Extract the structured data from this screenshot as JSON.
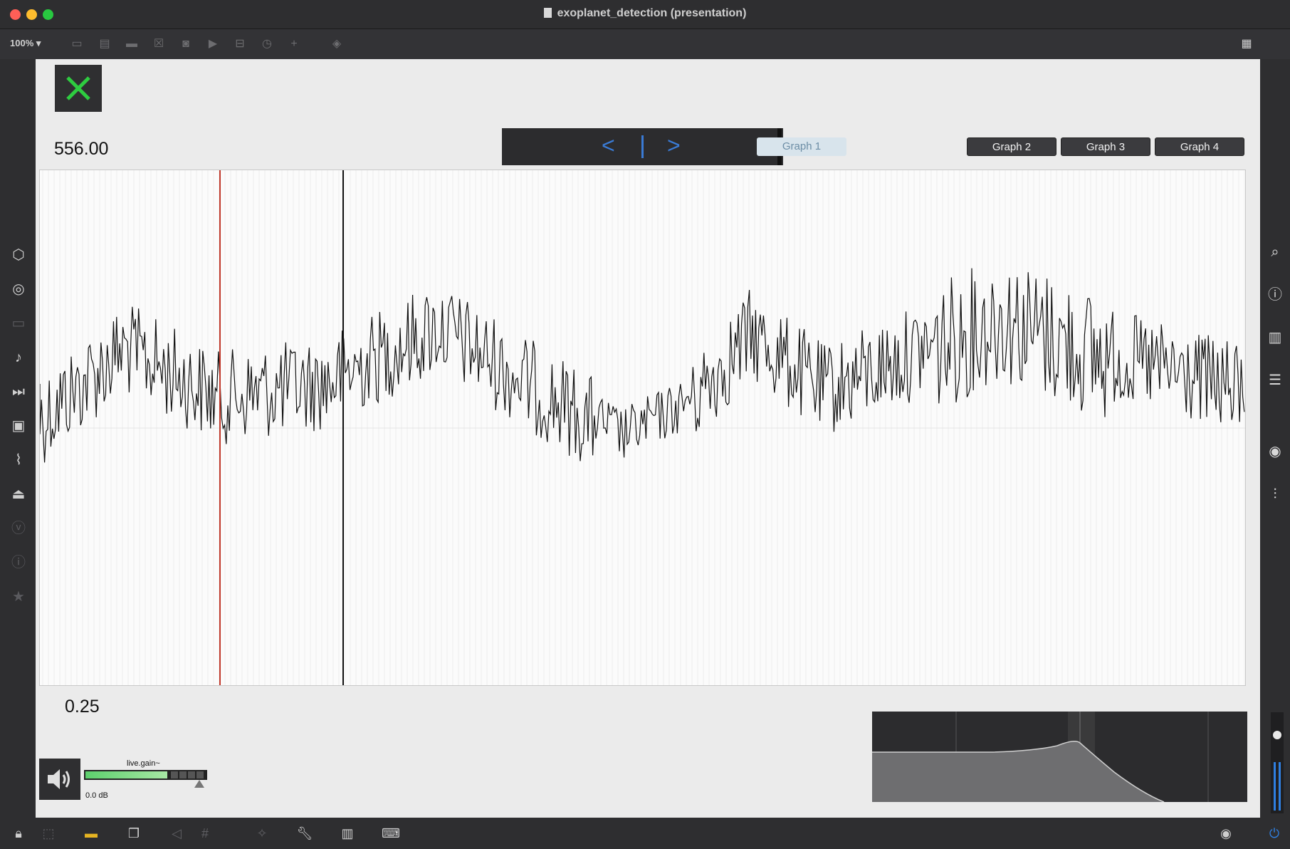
{
  "window": {
    "title": "exoplanet_detection (presentation)"
  },
  "toolbar": {
    "zoom": "100%"
  },
  "main": {
    "top_value": "556.00",
    "bottom_value": "0.25",
    "nav": {
      "prev": "<",
      "next": ">"
    },
    "tabs": [
      "Graph 1",
      "Graph 2",
      "Graph 3",
      "Graph 4"
    ],
    "active_tab": "Graph 1",
    "gain": {
      "label": "live.gain~",
      "value": "0.0 dB",
      "level_fraction": 0.68
    }
  },
  "colors": {
    "playhead": "#c0392b",
    "signal": "#111111",
    "accent": "#3a7bd5",
    "close_icon": "#2ecc40"
  },
  "icons": {
    "left": [
      "cube-icon",
      "target-icon",
      "film-icon",
      "note-icon",
      "step-icon",
      "image-icon",
      "clip-icon",
      "plug-icon",
      "v-icon",
      "info-circle-icon",
      "star-icon"
    ],
    "right": [
      "search-icon",
      "info-icon",
      "columns-icon",
      "list-icon",
      "camera-icon",
      "sliders-icon"
    ]
  }
}
